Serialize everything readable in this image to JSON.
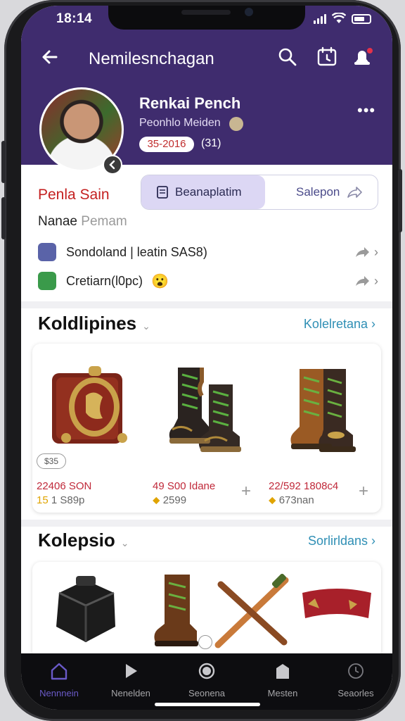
{
  "status": {
    "time": "18:14"
  },
  "topbar": {
    "title": "Nemilesnchagan"
  },
  "profile": {
    "name": "Renkai Pench",
    "subtitle": "Peonhlo Meiden",
    "badge": "35-2016",
    "count": "(31)"
  },
  "segment": {
    "section_label": "Penla Sain",
    "active_label": "Beanaplatim",
    "inactive_label": "Salepon"
  },
  "name_field": {
    "label": "Nanae",
    "placeholder": "Pemam"
  },
  "info_rows": [
    {
      "text": "Sondoland | leatin SAS8)",
      "icon": "chat-icon"
    },
    {
      "text": "Cretiarn(l0pc)",
      "icon": "shop-icon",
      "emoji": "😮"
    }
  ],
  "section1": {
    "title": "Koldlipines",
    "link": "Kolelretana",
    "products": [
      {
        "name": "leather-pouch",
        "tag": "$35",
        "price": "22406 SON",
        "sub_gold": "15",
        "sub": "1 S89p"
      },
      {
        "name": "green-lace-boots",
        "price": "49 S00 Idane",
        "sub_gold": "",
        "sub": "2599"
      },
      {
        "name": "brown-boots",
        "price": "22/592 1808c4",
        "sub_gold": "",
        "sub": "673nan"
      }
    ]
  },
  "section2": {
    "title": "Kolepsio",
    "link": "Sorlirldans"
  },
  "bottom_nav": [
    {
      "label": "Nennnein",
      "icon": "home-icon",
      "active": true
    },
    {
      "label": "Nenelden",
      "icon": "play-icon"
    },
    {
      "label": "Seonena",
      "icon": "circle-icon"
    },
    {
      "label": "Mesten",
      "icon": "bag-icon"
    },
    {
      "label": "Seaorles",
      "icon": "clock-icon"
    }
  ],
  "colors": {
    "header": "#3f2c6e",
    "accent_red": "#c42020",
    "link": "#2f8fb5",
    "segment_active": "#dcd7f4"
  }
}
